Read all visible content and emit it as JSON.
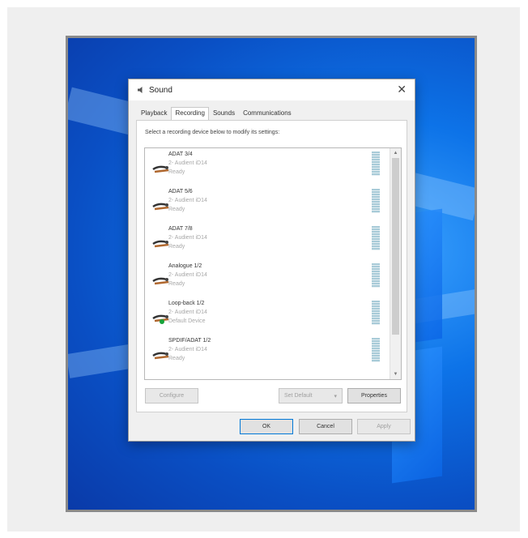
{
  "dialog": {
    "title": "Sound",
    "close_label": "✕"
  },
  "tabs": [
    {
      "label": "Playback"
    },
    {
      "label": "Recording"
    },
    {
      "label": "Sounds"
    },
    {
      "label": "Communications"
    }
  ],
  "instruction": "Select a recording device below to modify its settings:",
  "devices": [
    {
      "name": "ADAT 3/4",
      "sub": "2- Audient iD14",
      "status": "Ready"
    },
    {
      "name": "ADAT 5/6",
      "sub": "2- Audient iD14",
      "status": "Ready"
    },
    {
      "name": "ADAT 7/8",
      "sub": "2- Audient iD14",
      "status": "Ready"
    },
    {
      "name": "Analogue 1/2",
      "sub": "2- Audient iD14",
      "status": "Ready"
    },
    {
      "name": "Loop-back 1/2",
      "sub": "2- Audient iD14",
      "status": "Default Device"
    },
    {
      "name": "SPDIF/ADAT 1/2",
      "sub": "2- Audient iD14",
      "status": "Ready"
    }
  ],
  "scrollbar": {
    "up": "▲",
    "down": "▼"
  },
  "buttons": {
    "configure": "Configure",
    "set_default": "Set Default",
    "set_default_arrow": "▾",
    "properties": "Properties",
    "ok": "OK",
    "cancel": "Cancel",
    "apply": "Apply"
  },
  "colors": {
    "desktop_blue": "#0d73e8",
    "default_indicator": "#16a33a",
    "focus_border": "#0078d7"
  }
}
